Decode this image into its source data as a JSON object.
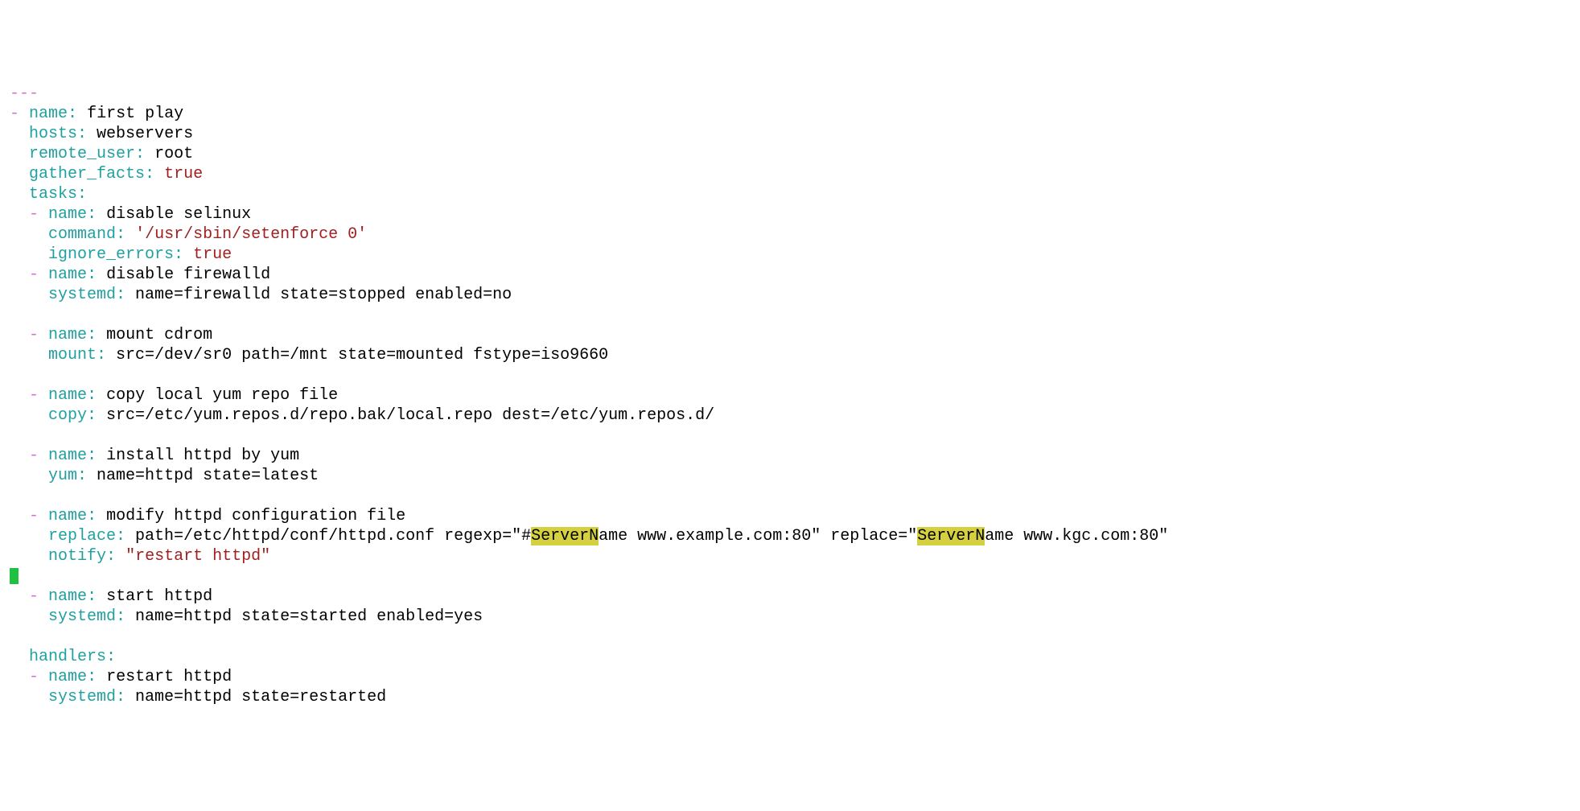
{
  "doc_start": "---",
  "play": {
    "name_key": "name",
    "name_val": " first play",
    "hosts_key": "hosts",
    "hosts_val": " webservers",
    "remote_user_key": "remote_user",
    "remote_user_val": " root",
    "gather_facts_key": "gather_facts",
    "gather_facts_val": "true",
    "tasks_key": "tasks"
  },
  "tasks": [
    {
      "name_key": "name",
      "name_val": " disable selinux",
      "mod_key": "command",
      "mod_val": "'/usr/sbin/setenforce 0'",
      "extra_key": "ignore_errors",
      "extra_val": "true"
    },
    {
      "name_key": "name",
      "name_val": " disable firewalld",
      "mod_key": "systemd",
      "mod_val": " name=firewalld state=stopped enabled=no"
    },
    {
      "name_key": "name",
      "name_val": " mount cdrom",
      "mod_key": "mount",
      "mod_val": " src=/dev/sr0 path=/mnt state=mounted fstype=iso9660"
    },
    {
      "name_key": "name",
      "name_val": " copy local yum repo file",
      "mod_key": "copy",
      "mod_val": " src=/etc/yum.repos.d/repo.bak/local.repo dest=/etc/yum.repos.d/"
    },
    {
      "name_key": "name",
      "name_val": " install httpd by yum",
      "mod_key": "yum",
      "mod_val": " name=httpd state=latest"
    },
    {
      "name_key": "name",
      "name_val": " modify httpd configuration file",
      "mod_key": "replace",
      "mod_pre": " path=/etc/httpd/conf/httpd.conf regexp=\"#",
      "hl1": "ServerN",
      "mod_mid": "ame www.example.com:80\" replace=\"",
      "hl2": "ServerN",
      "mod_post": "ame www.kgc.com:80\"",
      "notify_key": "notify",
      "notify_val": "\"restart httpd\""
    },
    {
      "name_key": "name",
      "name_val": " start httpd",
      "mod_key": "systemd",
      "mod_val": " name=httpd state=started enabled=yes"
    }
  ],
  "handlers_key": "handlers",
  "handlers": [
    {
      "name_key": "name",
      "name_val": " restart httpd",
      "mod_key": "systemd",
      "mod_val": " name=httpd state=restarted"
    }
  ]
}
